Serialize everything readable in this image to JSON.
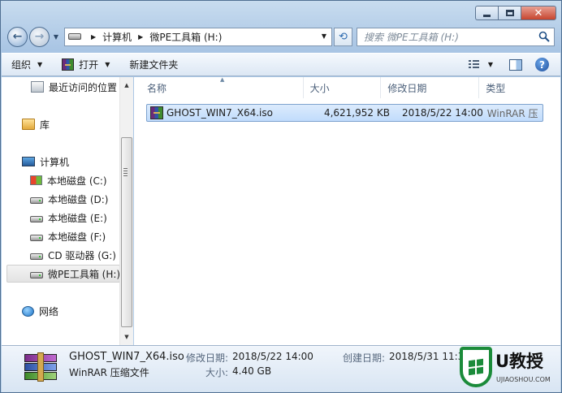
{
  "window": {
    "caption": {
      "minimize": "minimize",
      "maximize": "maximize",
      "close": "✕"
    }
  },
  "address": {
    "segments": [
      "计算机",
      "微PE工具箱 (H:)"
    ],
    "search_placeholder": "搜索 微PE工具箱 (H:)"
  },
  "toolbar": {
    "organize": "组织",
    "open": "打开",
    "new_folder": "新建文件夹"
  },
  "navpane": {
    "recent": "最近访问的位置",
    "library": "库",
    "computer": "计算机",
    "drives": [
      {
        "label": "本地磁盘 (C:)",
        "icon": "windows-drive-icon"
      },
      {
        "label": "本地磁盘 (D:)",
        "icon": "drive-icon"
      },
      {
        "label": "本地磁盘 (E:)",
        "icon": "drive-icon"
      },
      {
        "label": "本地磁盘 (F:)",
        "icon": "drive-icon"
      },
      {
        "label": "CD 驱动器 (G:)",
        "icon": "drive-icon"
      },
      {
        "label": "微PE工具箱 (H:)",
        "icon": "drive-icon"
      }
    ],
    "network": "网络"
  },
  "columns": {
    "name": "名称",
    "size": "大小",
    "modified": "修改日期",
    "type": "类型"
  },
  "files": [
    {
      "name": "GHOST_WIN7_X64.iso",
      "size": "4,621,952 KB",
      "modified": "2018/5/22 14:00",
      "type": "WinRAR 压"
    }
  ],
  "details": {
    "name": "GHOST_WIN7_X64.iso",
    "type": "WinRAR 压缩文件",
    "modified_label": "修改日期:",
    "modified": "2018/5/22 14:00",
    "size_label": "大小:",
    "size": "4.40 GB",
    "created_label": "创建日期:",
    "created": "2018/5/31 11:33"
  },
  "watermark": {
    "title": "U教授",
    "subtitle": "UJIAOSHOU.COM"
  },
  "colors": {
    "selection": "#c1dcfc",
    "brand_green": "#1b8b3a"
  }
}
